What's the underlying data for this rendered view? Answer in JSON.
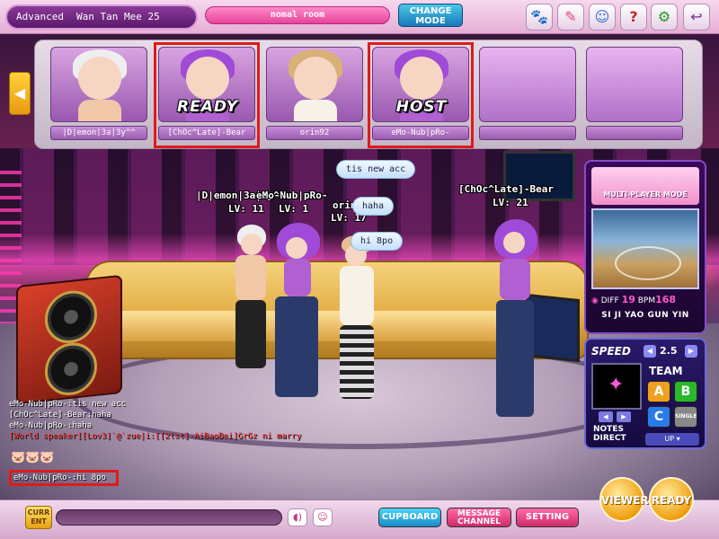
{
  "top": {
    "player_mode": "Advanced",
    "player_name": "Wan Tan Mee 25",
    "room_name": "nomal room",
    "change_mode_line1": "CHANGE",
    "change_mode_line2": "MODE"
  },
  "slots": [
    {
      "name": "|D|emon|3a|3y^^",
      "status": "",
      "hair": "#f0f0f0",
      "outfit": "#ffffff",
      "highlight": false
    },
    {
      "name": "[ChOc^Late]-Bear",
      "status": "READY",
      "hair": "#a04ad8",
      "outfit": "#ffffff",
      "highlight": true
    },
    {
      "name": "orin92",
      "status": "",
      "hair": "#e06a6a",
      "outfit": "#ffffff",
      "highlight": false
    },
    {
      "name": "eMo-Nub|pRo-",
      "status": "HOST",
      "hair": "#a04ad8",
      "outfit": "#ffffff",
      "highlight": true
    },
    {
      "name": "",
      "status": "",
      "empty": true
    },
    {
      "name": "",
      "status": "",
      "empty": true
    }
  ],
  "scene": {
    "labels": [
      {
        "text": "|D|emon|3a|3y^^",
        "level": "LV: 11"
      },
      {
        "text": "eMo-Nub|pRo-",
        "level": "LV: 1"
      },
      {
        "text": "orin92",
        "level": "LV: 17"
      },
      {
        "text": "[ChOc^Late]-Bear",
        "level": "LV: 21"
      }
    ],
    "bubbles": [
      "tis new acc",
      "haha",
      "hi 8po"
    ]
  },
  "song": {
    "mode_title": "MULTI-PLAYER MODE",
    "diff_label": "DIFF",
    "diff": "19",
    "bpm_label": "BPM",
    "bpm": "168",
    "title": "SI JI YAO GUN YIN"
  },
  "controls": {
    "speed_label": "SPEED",
    "speed_value": "2.5",
    "team_label": "TEAM",
    "notes_label_1": "NOTES",
    "notes_label_2": "DIRECT",
    "team_a": "A",
    "team_b": "B",
    "team_c": "C",
    "team_single": "SINGLE",
    "up_label": "UP"
  },
  "chat": {
    "lines": [
      {
        "text": "eMo-Nub|pRo-:tis new acc",
        "type": "normal"
      },
      {
        "text": "[ChOc^Late]-Bear:haha",
        "type": "normal"
      },
      {
        "text": "eMo-Nub|pRo-:haha",
        "type": "normal"
      },
      {
        "text": "[World speaker][Lov3]`@`zue|i:[[2lst]-AiBaoBei]GrGz ni marry",
        "type": "world"
      }
    ],
    "last_line": "eMo-Nub|pRo-:hi 8po"
  },
  "bottom": {
    "current_line1": "CURR",
    "current_line2": "ENT",
    "cupboard": "CUPBOARD",
    "message_line1": "MESSAGE",
    "message_line2": "CHANNEL",
    "setting": "SETTING",
    "viewer": "VIEWER",
    "ready": "READY"
  },
  "colors": {
    "accent_pink": "#e6449a",
    "highlight_red": "#e01a1a",
    "button_blue": "#1a88c8",
    "gold": "#f0a010"
  },
  "icons": [
    "paw-icon",
    "pen-icon",
    "person-icon",
    "help-icon",
    "gear-icon",
    "back-arrow-icon"
  ]
}
